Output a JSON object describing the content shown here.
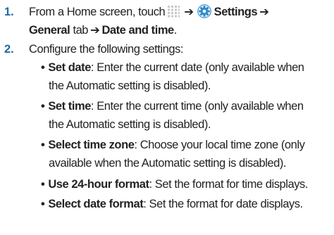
{
  "steps": [
    {
      "number": "1.",
      "prefix": "From a Home screen, touch",
      "arrow": "➔",
      "settings_label": "Settings",
      "general_tab": "General",
      "general_tab_suffix": " tab",
      "date_and_time": "Date and time",
      "period": "."
    },
    {
      "number": "2.",
      "text": "Configure the following settings:"
    }
  ],
  "bullet_char": "•",
  "settings": [
    {
      "term": "Set date",
      "line1": ": Enter the current date (only available when",
      "line2": "the Automatic setting is disabled)."
    },
    {
      "term": "Set time",
      "line1": ": Enter the current time (only available when",
      "line2": "the Automatic setting is disabled)."
    },
    {
      "term": "Select time zone",
      "line1": ": Choose your local time zone (only",
      "line2": "available when the Automatic setting is disabled)."
    },
    {
      "term": "Use 24-hour format",
      "line1": ": Set the format for time displays.",
      "line2": ""
    },
    {
      "term": "Select date format",
      "line1": ": Set the format for date displays.",
      "line2": ""
    }
  ],
  "icons": {
    "apps": "apps-grid-icon",
    "settings": "settings-gear-icon"
  },
  "colors": {
    "step_number": "#2469a3",
    "text": "#222222",
    "gear_blue": "#2a87c9"
  }
}
